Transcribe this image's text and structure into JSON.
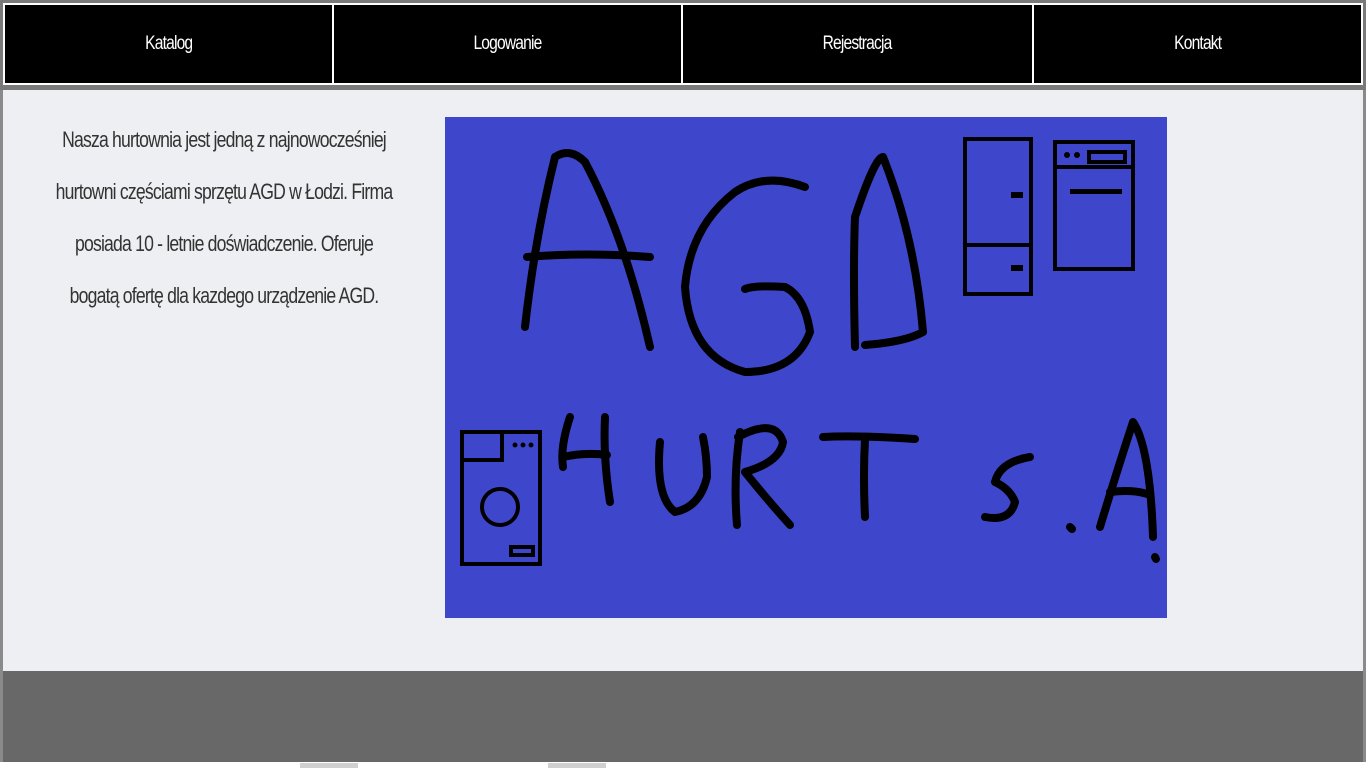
{
  "nav": {
    "items": [
      {
        "label": "Katalog"
      },
      {
        "label": "Logowanie"
      },
      {
        "label": "Rejestracja"
      },
      {
        "label": "Kontakt"
      }
    ]
  },
  "main": {
    "intro_text": "Nasza hurtownia jest jedną z najnowocześniej hurtowni częściami sprzętu AGD w Łodzi. Firma posiada 10 - letnie doświadczenie. Oferuje bogatą ofertę dla kazdego urządzenie AGD.",
    "logo": {
      "line1": "AGD",
      "line2": "HURT S.A",
      "background": "#3e47cc",
      "icons": [
        "fridge-icon",
        "oven-icon",
        "washing-machine-icon"
      ]
    }
  },
  "colors": {
    "nav_bg": "#000000",
    "nav_text": "#ffffff",
    "content_bg": "#eeeff2",
    "footer_bg": "#686868"
  }
}
